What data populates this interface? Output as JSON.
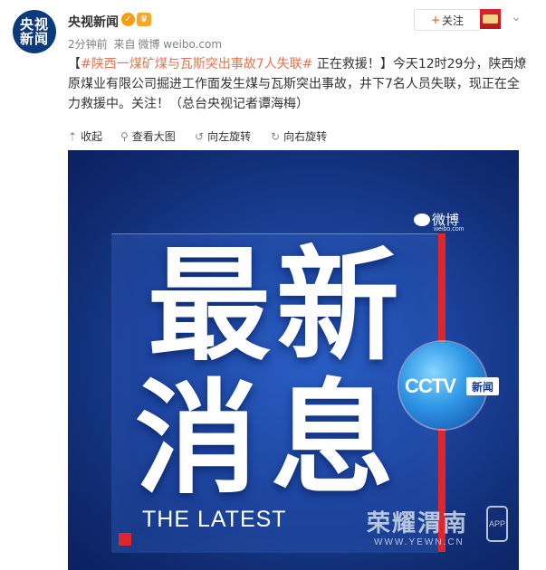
{
  "header": {
    "avatar_top": "央视",
    "avatar_bottom": "新闻",
    "username": "央视新闻",
    "verified_icon": "verified-badge-icon",
    "vip_icon": "vip-icon",
    "meta_time": "2分钟前",
    "meta_source": "来自",
    "meta_site": "微博 weibo.com",
    "follow_label": "关注"
  },
  "post": {
    "prefix": "【",
    "topic": "#陕西一煤矿煤与瓦斯突出事故7人失联#",
    "status": " 正在救援！】",
    "body": "今天12时29分，陕西燎原煤业有限公司掘进工作面发生煤与瓦斯突出事故，井下7名人员失联，现正在全力救援中。关注！（总台央视记者谭海梅）"
  },
  "toolbar": {
    "collapse": "收起",
    "view_large": "查看大图",
    "rotate_left": "向左旋转",
    "rotate_right": "向右旋转"
  },
  "image": {
    "weibo_logo": "微博",
    "weibo_url": "weibo.com",
    "line1": "最新",
    "line2": "消息",
    "latest": "THE LATEST",
    "cctv": "CCTV",
    "cctv_cn": "新闻",
    "watermark": "荣耀渭南",
    "watermark_url": "WWW.YEWN.CN",
    "app": "APP"
  }
}
